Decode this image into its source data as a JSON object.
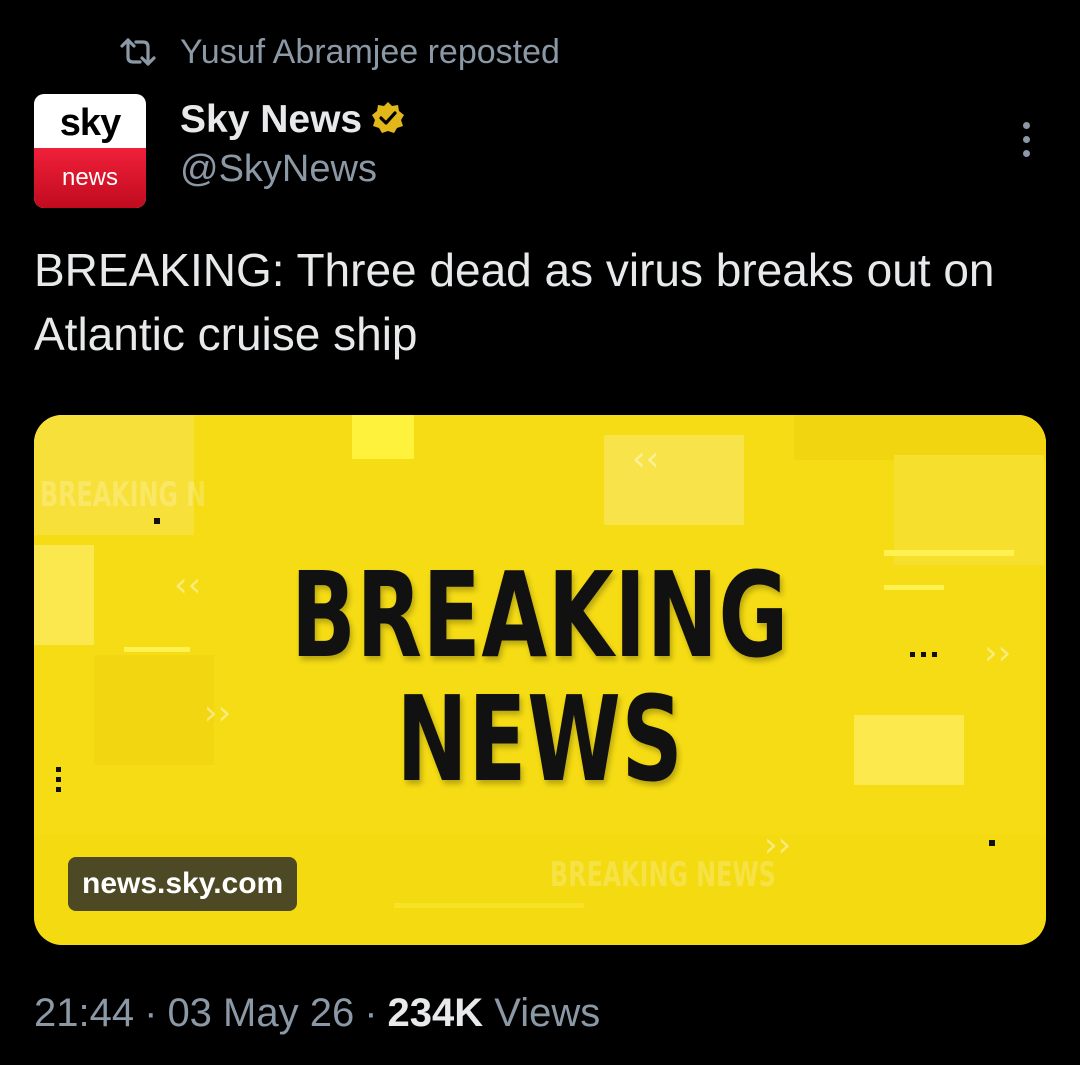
{
  "repost": {
    "icon": "repost-icon",
    "text": "Yusuf Abramjee reposted"
  },
  "author": {
    "avatar_top": "sky",
    "avatar_bottom": "news",
    "display_name": "Sky News",
    "verified_icon": "verified-badge-icon",
    "verified_color": "#e2b719",
    "handle": "@SkyNews"
  },
  "tweet": {
    "text": "BREAKING: Three dead as virus breaks out on Atlantic cruise ship"
  },
  "card": {
    "headline_line1": "BREAKING",
    "headline_line2": "NEWS",
    "background_color": "#f5dc14",
    "domain": "news.sky.com"
  },
  "meta": {
    "time": "21:44",
    "sep1": "·",
    "date": "03 May 26",
    "sep2": "·",
    "views_count": "234K",
    "views_label": "Views"
  },
  "colors": {
    "text": "#e7e9ea",
    "muted": "#8b98a5",
    "background": "#000000",
    "sky_red": "#e0142c"
  }
}
